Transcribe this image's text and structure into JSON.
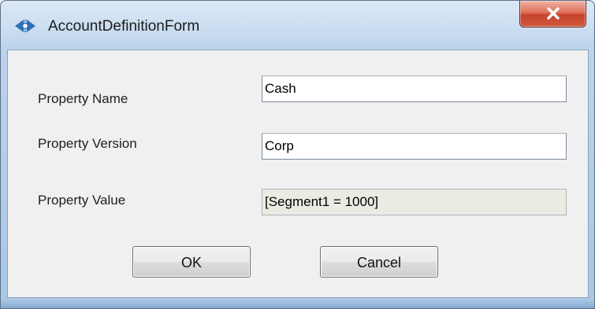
{
  "window": {
    "title": "AccountDefinitionForm",
    "app_icon": "app-logo-icon",
    "close_icon": "close-icon"
  },
  "form": {
    "fields": [
      {
        "label": "Property Name",
        "value": "Cash",
        "readonly": false
      },
      {
        "label": "Property Version",
        "value": "Corp",
        "readonly": false
      },
      {
        "label": "Property Value",
        "value": "[Segment1 = 1000]",
        "readonly": true
      }
    ]
  },
  "buttons": {
    "ok_label": "OK",
    "cancel_label": "Cancel"
  },
  "colors": {
    "close_button": "#c6412a",
    "readonly_field": "#ebebe4"
  }
}
